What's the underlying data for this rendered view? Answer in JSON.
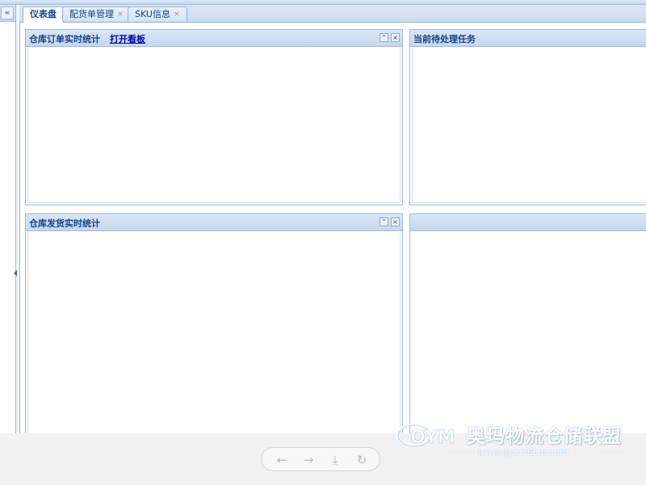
{
  "left_panel": {
    "collapse_symbol": "«"
  },
  "tabs": [
    {
      "label": "仪表盘",
      "closable": false,
      "active": true
    },
    {
      "label": "配货单管理",
      "closable": true,
      "active": false
    },
    {
      "label": "SKU信息",
      "closable": true,
      "active": false
    }
  ],
  "tab_close_symbol": "×",
  "portlets": {
    "order_stats": {
      "title": "仓库订单实时统计",
      "link": "打开看板"
    },
    "pending_tasks": {
      "title": "当前待处理任务"
    },
    "shipping_stats": {
      "title": "仓库发货实时统计"
    },
    "empty_panel": {
      "title": ""
    }
  },
  "tool_symbols": {
    "collapse": "⌃",
    "close": "×"
  },
  "viewer": {
    "prev": "←",
    "next": "→",
    "download": "⤓",
    "rotate": "↻"
  },
  "watermark": {
    "logo": "OYM",
    "text_cn": "奥玛物流仓储联盟",
    "url": "www.oym56Lm.com"
  },
  "icons": [
    "double-chevron-left-icon",
    "collapse-up-icon",
    "close-icon",
    "arrow-left-icon",
    "arrow-right-icon",
    "download-icon",
    "rotate-icon"
  ],
  "colors": {
    "header_blue": "#c5d8f0",
    "border_blue": "#99bbe8",
    "title_text": "#15428b",
    "link": "#0000cc"
  }
}
